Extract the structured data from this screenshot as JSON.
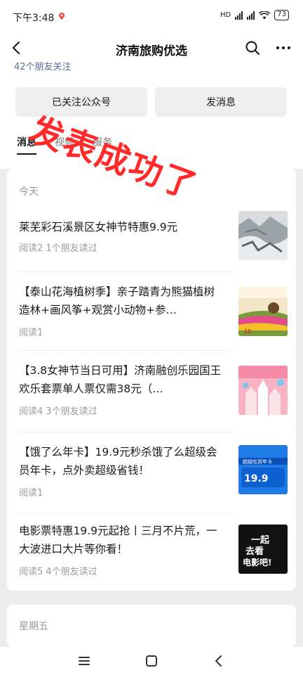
{
  "status_bar": {
    "time": "下午3:48",
    "network": "HD",
    "battery": "73"
  },
  "header": {
    "title": "济南旅购优选"
  },
  "profile": {
    "followers_text": "42个朋友关注",
    "follow_button": "已关注公众号",
    "message_button": "发消息",
    "tabs": [
      {
        "label": "消息"
      },
      {
        "label": "视频"
      },
      {
        "label": "服务"
      }
    ]
  },
  "sections": [
    {
      "label": "今天",
      "articles": [
        {
          "title": "莱芜彩石溪景区女神节特惠9.9元",
          "meta": "阅读2  1个朋友读过",
          "thumb": "snowy-landscape"
        },
        {
          "title": "【泰山花海植树季】亲子踏青为熊猫植树造林+画风筝+观赏小动物+参…",
          "meta": "阅读1",
          "thumb": "flower-field-poster",
          "thumb_price": "58"
        },
        {
          "title": "【3.8女神节当日可用】济南融创乐园国王欢乐套票单人票仅需38元（…",
          "meta": "阅读4  3个朋友读过",
          "thumb": "pink-castle-poster"
        },
        {
          "title": "【饿了么年卡】19.9元秒杀饿了么超级会员年卡，点外卖超级省钱！",
          "meta": "阅读1",
          "thumb": "eleme-card",
          "thumb_text": "超级吃货年卡",
          "thumb_price": "19.9"
        },
        {
          "title": "电影票特惠19.9元起抢丨三月不片荒，一大波进口大片等你看！",
          "meta": "阅读5  4个朋友读过",
          "thumb": "movie-poster",
          "thumb_text_1": "一起",
          "thumb_text_2": "去看",
          "thumb_text_3": "电影吧!"
        }
      ]
    },
    {
      "label": "星期五"
    }
  ],
  "overlay_stamp": "发表成功了",
  "colors": {
    "stamp": "#ff2a2a",
    "link": "#576b95",
    "meta": "#9b9b9b",
    "background": "#ededed"
  }
}
